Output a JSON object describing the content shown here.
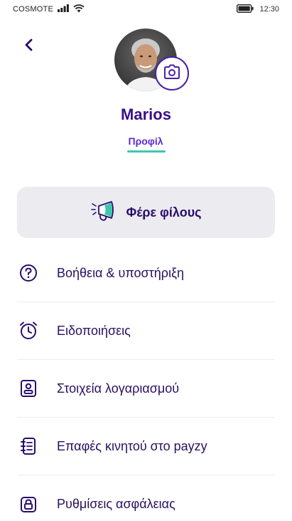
{
  "status_bar": {
    "carrier": "COSMOTE",
    "time": "12:30",
    "icons": [
      "signal-icon",
      "wifi-icon",
      "battery-icon"
    ]
  },
  "header": {
    "back_icon": "back-arrow-icon",
    "camera_icon": "camera-icon"
  },
  "profile": {
    "name": "Marios",
    "tab_label": "Προφίλ"
  },
  "invite": {
    "label": "Φέρε φίλους",
    "icon": "megaphone-icon"
  },
  "menu": {
    "items": [
      {
        "label": "Βοήθεια & υποστήριξη",
        "icon": "help-icon"
      },
      {
        "label": "Ειδοποιήσεις",
        "icon": "alarm-icon"
      },
      {
        "label": "Στοιχεία λογαριασμού",
        "icon": "account-card-icon"
      },
      {
        "label": "Επαφές κινητού στο payzy",
        "icon": "contacts-list-icon"
      },
      {
        "label": "Ρυθμίσεις ασφάλειας",
        "icon": "lock-icon"
      }
    ]
  },
  "colors": {
    "primary": "#3a0f8a",
    "accent": "#5b2bd0",
    "underline": "#3ec6b0",
    "invite_bg": "#ececf0",
    "megaphone_accent": "#3ec6b0"
  }
}
